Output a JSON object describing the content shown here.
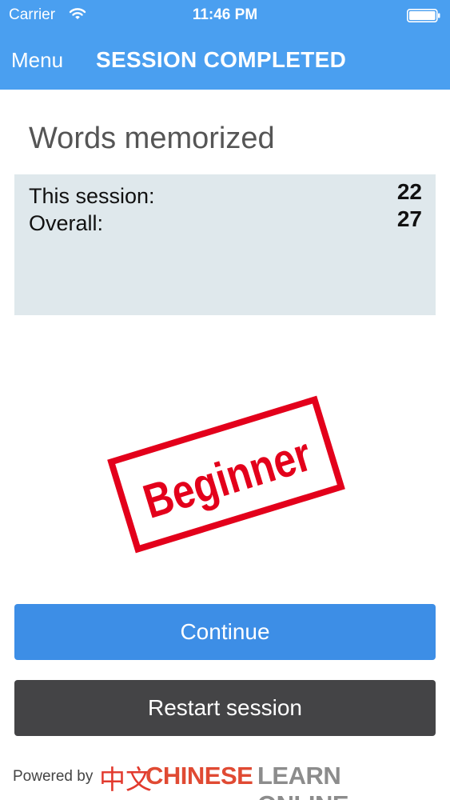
{
  "status_bar": {
    "carrier": "Carrier",
    "time": "11:46 PM"
  },
  "nav": {
    "menu_label": "Menu",
    "title": "SESSION COMPLETED"
  },
  "section": {
    "title": "Words memorized"
  },
  "stats": [
    {
      "label": "This session:",
      "value": "22"
    },
    {
      "label": "Overall:",
      "value": "27"
    }
  ],
  "stamp": {
    "text": "Beginner",
    "color": "#e3001b"
  },
  "actions": {
    "continue_label": "Continue",
    "restart_label": "Restart session"
  },
  "footer": {
    "powered_by": "Powered by",
    "logo_cjk": "中文",
    "logo_primary": "CHINESE",
    "logo_secondary": "LEARN ONLINE"
  },
  "colors": {
    "header": "#4a9ff0",
    "continue": "#3d8ee6",
    "restart": "#444446",
    "panel": "#dfe8ec"
  },
  "icons": [
    "wifi-icon",
    "battery-icon"
  ]
}
